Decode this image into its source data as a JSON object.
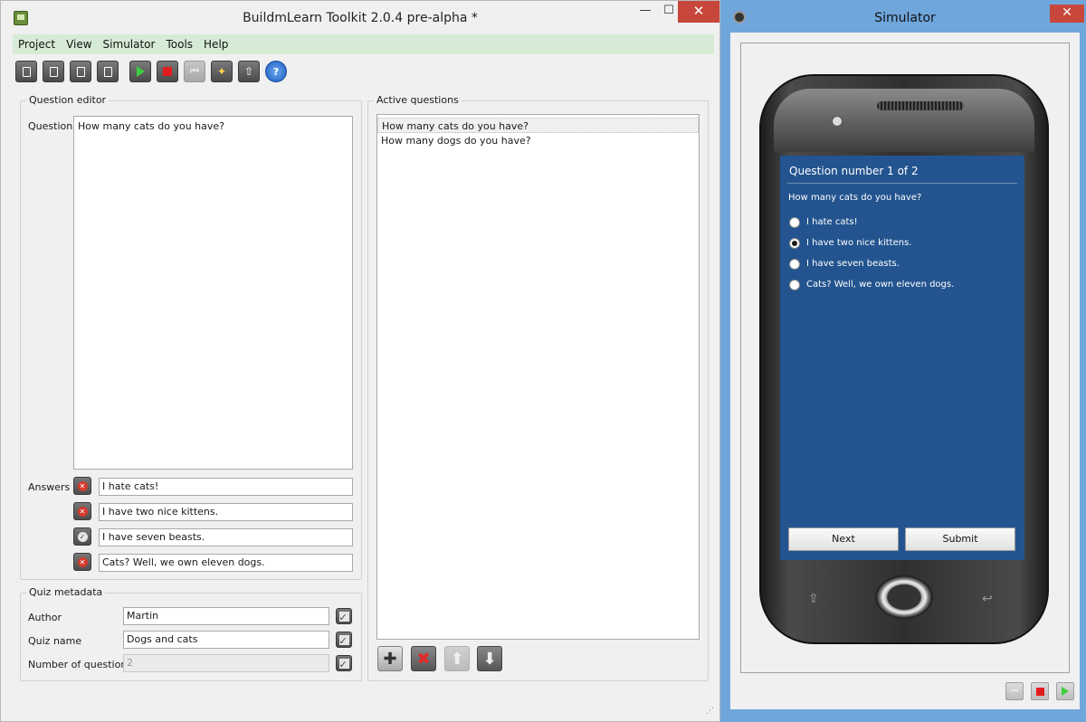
{
  "main": {
    "title": "BuildmLearn Toolkit 2.0.4 pre-alpha *",
    "menu": [
      "Project",
      "View",
      "Simulator",
      "Tools",
      "Help"
    ],
    "window_controls": {
      "minimize": "—",
      "maximize": "☐",
      "close": "✕"
    },
    "toolbar": {
      "help_glyph": "?",
      "first_glyph": "⏮"
    },
    "question_editor": {
      "title": "Question editor",
      "question_label": "Question",
      "question_text": "How many cats do you have?",
      "answers_label": "Answers",
      "answers": [
        {
          "text": "I hate cats!",
          "correct": false
        },
        {
          "text": "I have two nice kittens.",
          "correct": false
        },
        {
          "text": "I have seven beasts.",
          "correct": true
        },
        {
          "text": "Cats? Well, we own eleven dogs.",
          "correct": false
        }
      ]
    },
    "metadata": {
      "title": "Quiz metadata",
      "author_label": "Author",
      "author": "Martin",
      "quizname_label": "Quiz name",
      "quizname": "Dogs and cats",
      "numq_label": "Number of questions",
      "numq": "2"
    },
    "active_questions": {
      "title": "Active questions",
      "items": [
        "How many cats do you have?",
        "How many dogs do you have?"
      ],
      "selected_index": 0,
      "buttons": {
        "add": "✚",
        "remove": "✖",
        "up": "⬆",
        "down": "⬇"
      }
    },
    "grip": "⋰"
  },
  "simulator": {
    "title": "Simulator",
    "close": "✕",
    "screen": {
      "header": "Question number 1 of 2",
      "question": "How many cats do you have?",
      "options": [
        "I hate cats!",
        "I have two nice kittens.",
        "I have seven beasts.",
        "Cats? Well, we own eleven dogs."
      ],
      "checked_index": 1,
      "next_label": "Next",
      "submit_label": "Submit"
    },
    "softkeys": {
      "left": "⇪",
      "right": "↩"
    },
    "controls": {
      "first": "⏮"
    }
  }
}
